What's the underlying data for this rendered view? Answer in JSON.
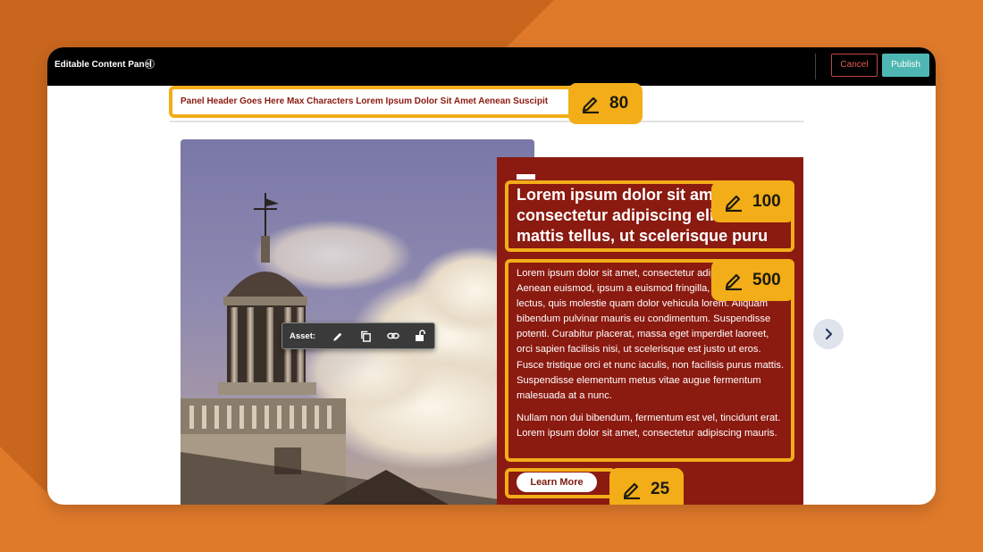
{
  "topbar": {
    "title": "Editable Content Panel",
    "info_icon": "info-icon",
    "cancel_label": "Cancel",
    "publish_label": "Publish"
  },
  "panel_header": {
    "text": "Panel Header Goes Here Max Characters Lorem Ipsum Dolor Sit Amet Aenean Suscipit",
    "char_limit": "80"
  },
  "asset_toolbar": {
    "label": "Asset:",
    "icons": [
      "pencil-icon",
      "copy-icon",
      "link-icon",
      "unlock-icon"
    ]
  },
  "content": {
    "headline": "Lorem ipsum dolor sit amet consectetur adipiscing elit. Nulla mattis tellus, ut scelerisque puru",
    "headline_char_limit": "100",
    "body_paragraph_1": "Lorem ipsum dolor sit amet, consectetur adipiscing elit. Aenean euismod, ipsum a euismod fringilla, sem nibh lectus, quis molestie quam dolor vehicula lorem. Aliquam bibendum pulvinar mauris eu condimentum. Suspendisse potenti. Curabitur placerat, massa eget imperdiet laoreet, orci sapien facilisis nisi, ut scelerisque est justo ut eros. Fusce tristique orci et nunc iaculis, non facilisis purus mattis. Suspendisse elementum metus vitae augue fermentum malesuada at a nunc.",
    "body_paragraph_2": "Nullam non dui bibendum, fermentum est vel, tincidunt erat. Lorem ipsum dolor sit amet, consectetur adipiscing mauris.",
    "body_char_limit": "500",
    "cta_label": "Learn More",
    "cta_char_limit": "25"
  },
  "navigation": {
    "next_icon": "chevron-right-icon"
  },
  "colors": {
    "background": "#e07a2b",
    "panel_red": "#8b1a10",
    "highlight": "#f2ad18",
    "publish": "#4fb7b3",
    "cancel": "#e35d55"
  }
}
